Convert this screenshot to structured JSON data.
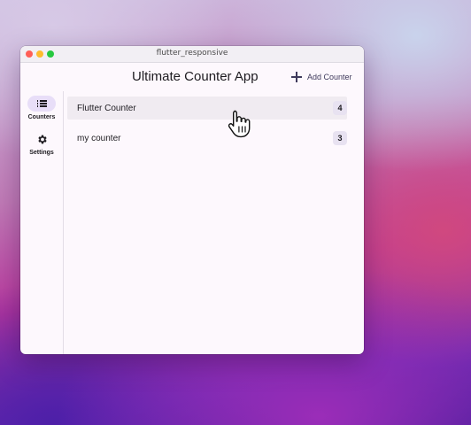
{
  "window": {
    "title": "flutter_responsive"
  },
  "appbar": {
    "title": "Ultimate Counter App",
    "add_label": "Add Counter",
    "add_icon": "plus-icon"
  },
  "rail": {
    "items": [
      {
        "label": "Counters",
        "icon": "list-icon",
        "selected": true
      },
      {
        "label": "Settings",
        "icon": "gear-icon",
        "selected": false
      }
    ]
  },
  "counters": [
    {
      "name": "Flutter Counter",
      "count": "4",
      "hovered": true
    },
    {
      "name": "my counter",
      "count": "3",
      "hovered": false
    }
  ],
  "colors": {
    "window_bg": "#fdf8fd",
    "rail_selected": "#e8def8",
    "badge_bg": "#e8e2f1",
    "row_hover": "#f0ebf1",
    "traffic_close": "#ff5f57",
    "traffic_min": "#febc2e",
    "traffic_max": "#28c840"
  }
}
